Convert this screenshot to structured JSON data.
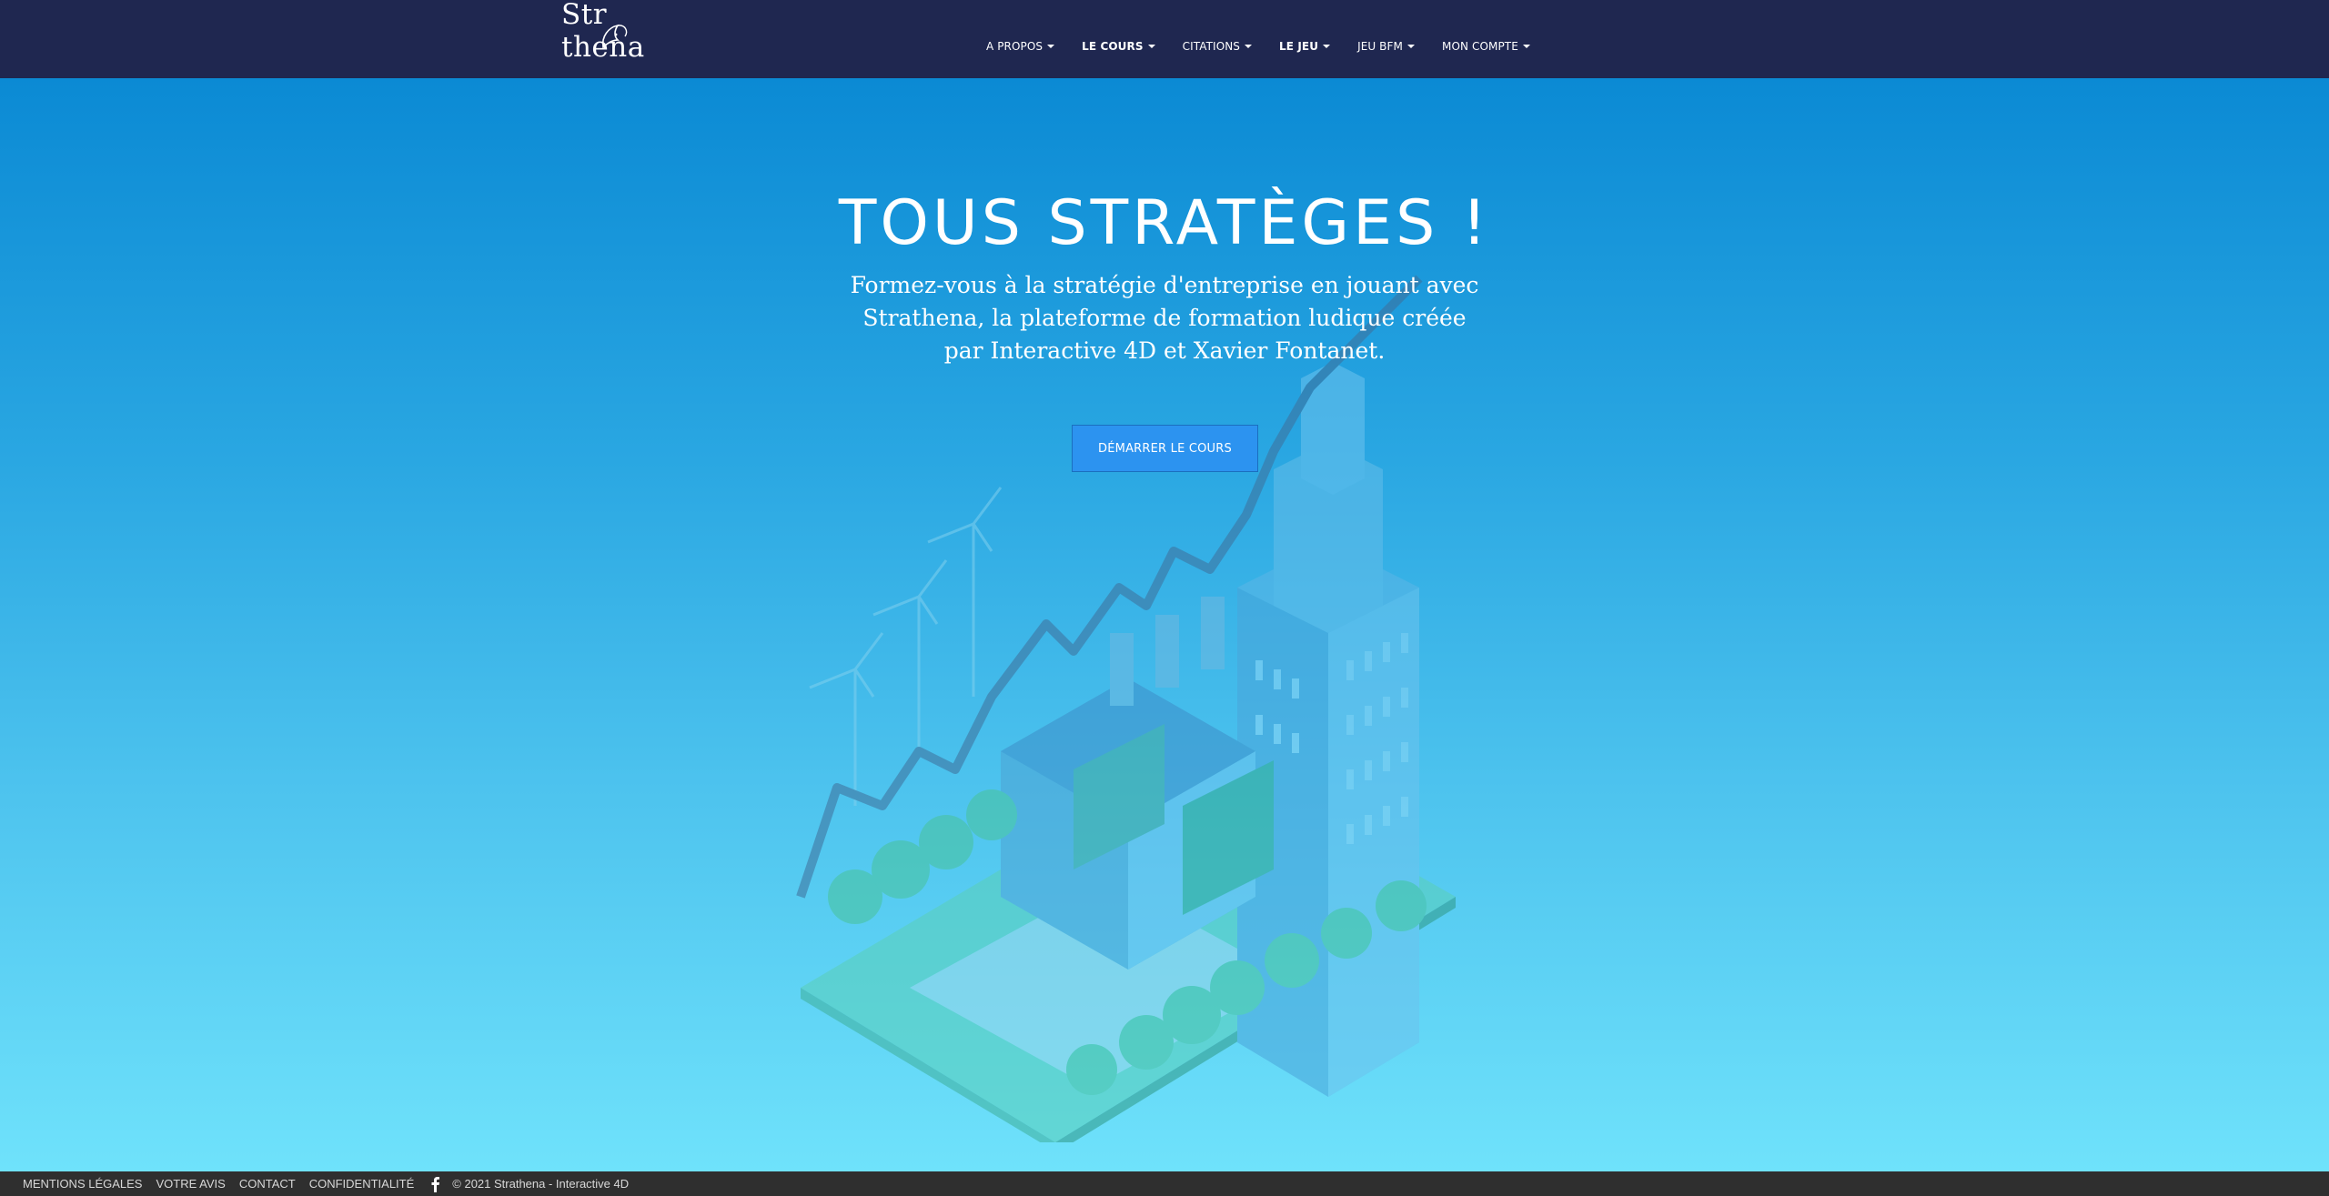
{
  "brand": {
    "logo_text": "Str thena"
  },
  "nav": {
    "items": [
      {
        "label": "A PROPOS"
      },
      {
        "label": "LE COURS"
      },
      {
        "label": "CITATIONS"
      },
      {
        "label": "LE JEU"
      },
      {
        "label": "JEU BFM"
      },
      {
        "label": "MON COMPTE"
      }
    ]
  },
  "hero": {
    "title": "TOUS STRATÈGES !",
    "subtitle": "Formez-vous à la stratégie d'entreprise en jouant avec Strathena, la plateforme de formation ludique créée par Interactive 4D et Xavier Fontanet.",
    "cta_label": "DÉMARRER LE COURS"
  },
  "footer": {
    "links": [
      "MENTIONS LÉGALES",
      "VOTRE AVIS",
      "CONTACT",
      "CONFIDENTIALITÉ"
    ],
    "social_icon": "facebook-icon",
    "copyright": "© 2021 Strathena - Interactive 4D"
  },
  "colors": {
    "navbar_bg": "#1f2750",
    "hero_top": "#0b8ad4",
    "hero_bottom": "#6fe2fb",
    "cta_bg": "#2c93f0",
    "footer_bg": "#2f2f2f"
  }
}
